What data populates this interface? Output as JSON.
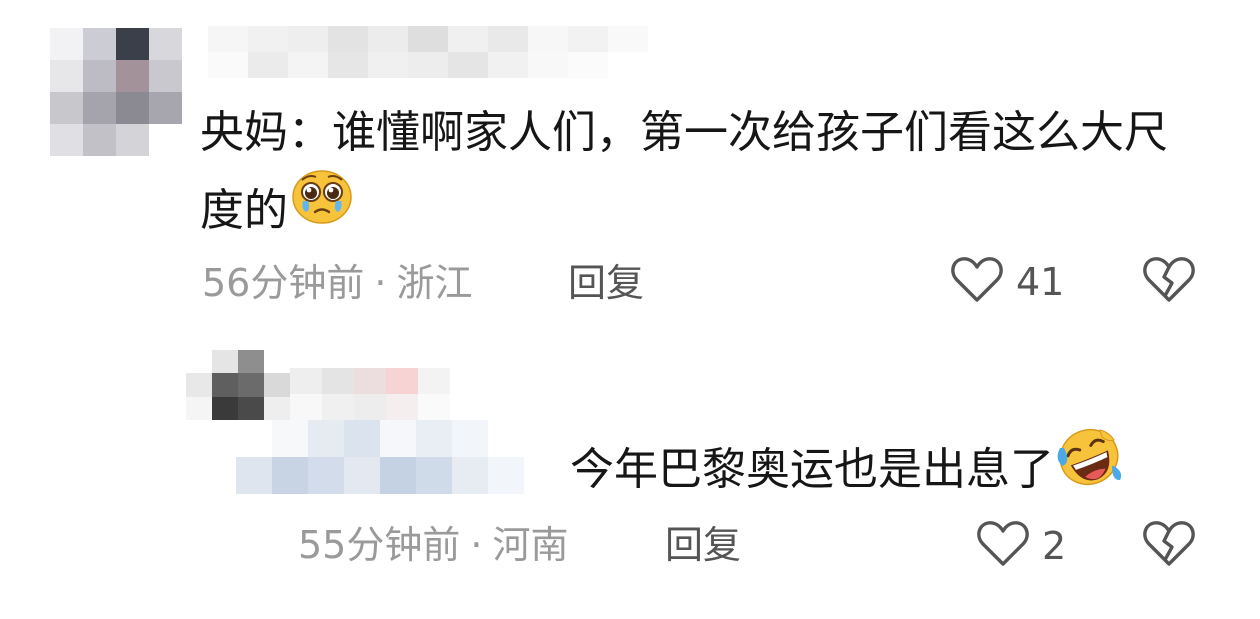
{
  "comments": [
    {
      "avatar_colors": [
        "#f2f2f4",
        "#ccccd4",
        "#3a3f4a",
        "#d7d7dc",
        "#e7e7ea",
        "#bdbcc4",
        "#a4929a",
        "#c9c8ce",
        "#c8c7cc",
        "#a5a3ab",
        "#8b8a93",
        "#a7a6ae",
        "#e0e0e4",
        "#c2c1c8",
        "#d4d4d8",
        "#ffffff"
      ],
      "name_colors": [
        "#f6f6f6",
        "#f1f1f1",
        "#eeeeee",
        "#e3e3e3",
        "#ececec",
        "#dedede",
        "#f0f0f0",
        "#e9e9e9",
        "#f7f7f7",
        "#f2f2f2",
        "#f9f9f9",
        "#fafafa",
        "#ebebeb",
        "#f4f4f4",
        "#e6e6e6",
        "#f0f0f0",
        "#ededed",
        "#e5e5e5",
        "#f1f1f1",
        "#f8f8f8",
        "#fbfbfb",
        "#ffffff"
      ],
      "text": "央妈：谁懂啊家人们，第一次给孩子们看这么大尺度的",
      "emoji": "pleading-face-emoji",
      "time": "56分钟前",
      "separator": "·",
      "location": "浙江",
      "reply_label": "回复",
      "like_count": "41"
    },
    {
      "avatar_colors": [
        "#ffffff",
        "#e5e5e5",
        "#8e8e8e",
        "#ffffff",
        "#e8e8e8",
        "#5f5f60",
        "#6b6b6c",
        "#d9d9d9",
        "#f5f5f5",
        "#3a3a3b",
        "#4a4a4a",
        "#eeeeee"
      ],
      "name_colors": [
        "#eeeeee",
        "#e4e4e4",
        "#ecdede",
        "#f7d3d3",
        "#f3f3f3",
        "#f8f8f8",
        "#f0f0f0",
        "#ededed",
        "#f5eeee",
        "#fafafa"
      ],
      "target_colors": [
        "#ffffff",
        "#f7f8fa",
        "#e6ebf2",
        "#dbe3ee",
        "#f5f7fa",
        "#e9eef5",
        "#f2f5f9",
        "#ffffff",
        "#ffffff",
        "#dfe5ee",
        "#c8d4e4",
        "#d2dcea",
        "#e4e9f1",
        "#c5d2e4",
        "#d0dbe9",
        "#e7ecf3",
        "#f2f5f9",
        "#ffffff"
      ],
      "text": "今年巴黎奥运也是出息了",
      "emoji": "rolling-on-floor-laughing-emoji",
      "time": "55分钟前",
      "separator": "·",
      "location": "河南",
      "reply_label": "回复",
      "like_count": "2"
    }
  ]
}
